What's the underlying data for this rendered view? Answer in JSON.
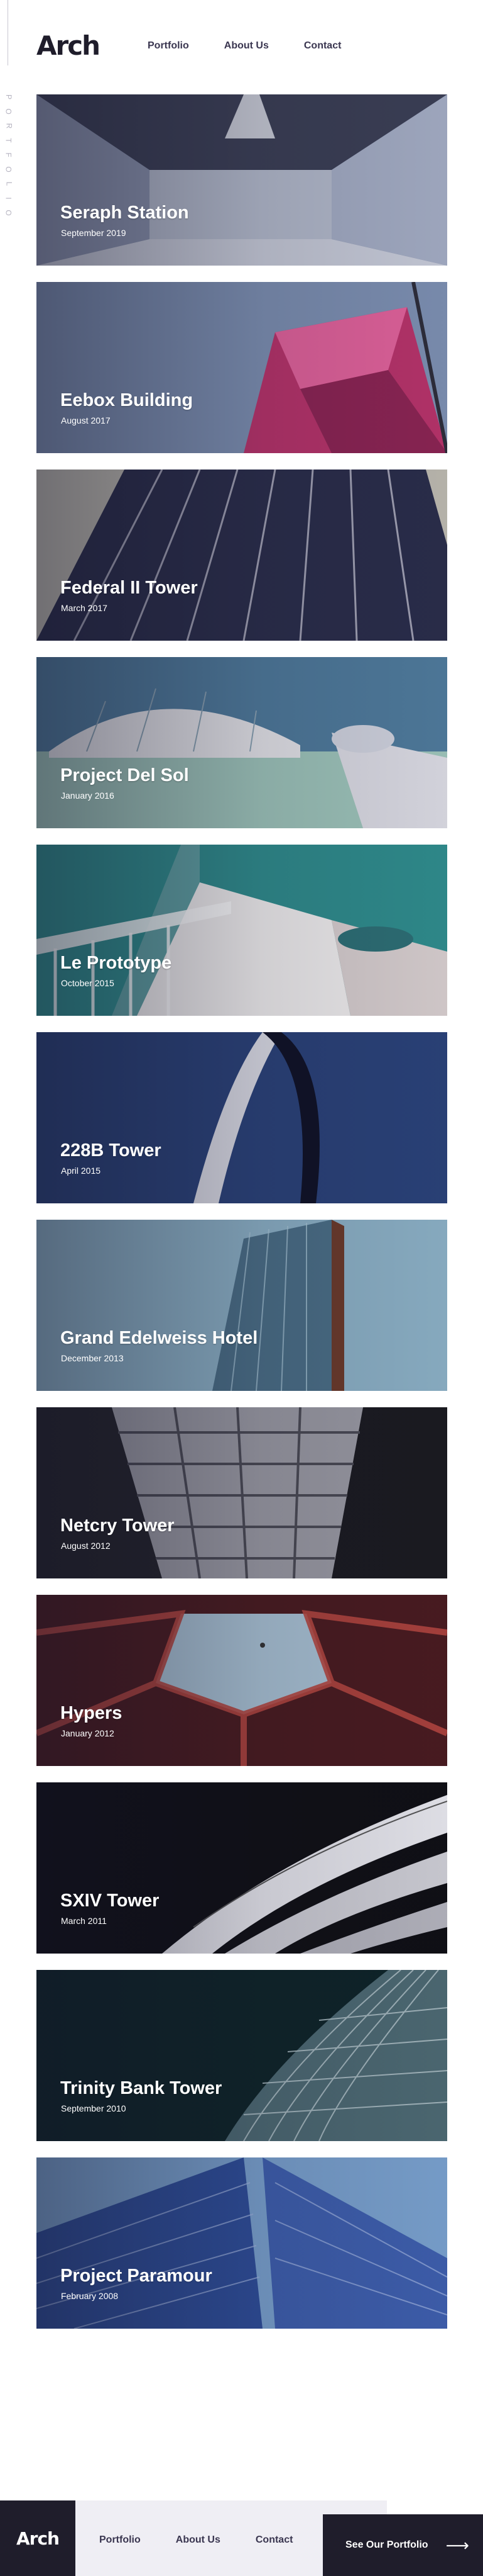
{
  "header": {
    "logo": "Arch",
    "nav": [
      "Portfolio",
      "About Us",
      "Contact"
    ]
  },
  "side_label": "PORTFOLIO",
  "projects": [
    {
      "title": "Seraph Station",
      "date": "September 2019"
    },
    {
      "title": "Eebox Building",
      "date": "August 2017"
    },
    {
      "title": "Federal II Tower",
      "date": "March 2017"
    },
    {
      "title": "Project Del Sol",
      "date": "January 2016"
    },
    {
      "title": "Le Prototype",
      "date": "October 2015"
    },
    {
      "title": "228B Tower",
      "date": "April 2015"
    },
    {
      "title": "Grand Edelweiss Hotel",
      "date": "December 2013"
    },
    {
      "title": "Netcry Tower",
      "date": "August 2012"
    },
    {
      "title": "Hypers",
      "date": "January 2012"
    },
    {
      "title": "SXIV Tower",
      "date": "March 2011"
    },
    {
      "title": "Trinity Bank Tower",
      "date": "September 2010"
    },
    {
      "title": "Project Paramour",
      "date": "February 2008"
    }
  ],
  "footer": {
    "logo": "Arch",
    "nav": [
      "Portfolio",
      "About Us",
      "Contact"
    ],
    "cta": "See Our Portfolio",
    "cta_icon": "arrow-right-icon"
  }
}
